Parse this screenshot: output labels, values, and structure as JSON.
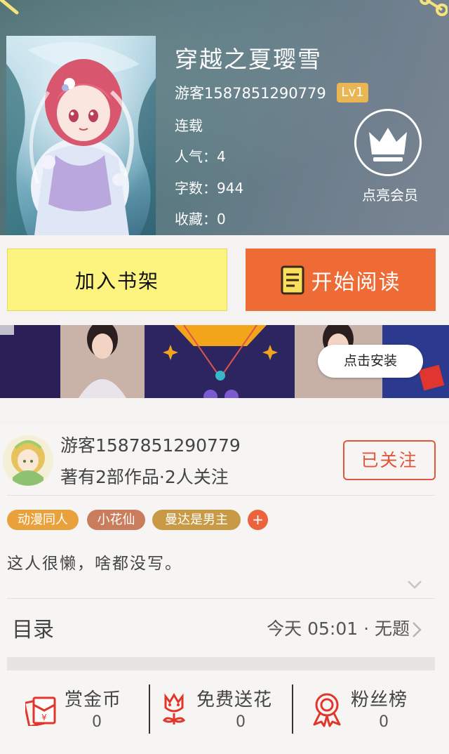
{
  "book": {
    "title": "穿越之夏璎雪",
    "author": "游客1587851290779",
    "level": "Lv1",
    "status": "连载",
    "popularity": "人气：4",
    "word_count": "字数：944",
    "favorites": "收藏：0",
    "vip_label": "点亮会员"
  },
  "actions": {
    "add_shelf": "加入书架",
    "start_read": "开始阅读"
  },
  "ad": {
    "install_label": "点击安装"
  },
  "author_card": {
    "name": "游客1587851290779",
    "stats": "著有2部作品·2人关注",
    "follow_label": "已关注",
    "tags": [
      "动漫同人",
      "小花仙",
      "曼达是男主"
    ],
    "tag_add": "+",
    "bio": "这人很懒，啥都没写。"
  },
  "toc": {
    "label": "目录",
    "latest": "今天 05:01 · 无题"
  },
  "stats_bar": [
    {
      "label": "赏金币",
      "count": "0",
      "icon": "red-envelope-icon"
    },
    {
      "label": "免费送花",
      "count": "0",
      "icon": "flower-icon"
    },
    {
      "label": "粉丝榜",
      "count": "0",
      "icon": "medal-icon"
    }
  ],
  "colors": {
    "accent_orange": "#ee6b35",
    "shelf_yellow": "#fdf47f",
    "follow_red": "#e2543b",
    "level_badge": "#e9b653",
    "tag_orange": "#e9a13c",
    "tag_brown": "#c97d5c",
    "tag_gold": "#c99a45"
  }
}
